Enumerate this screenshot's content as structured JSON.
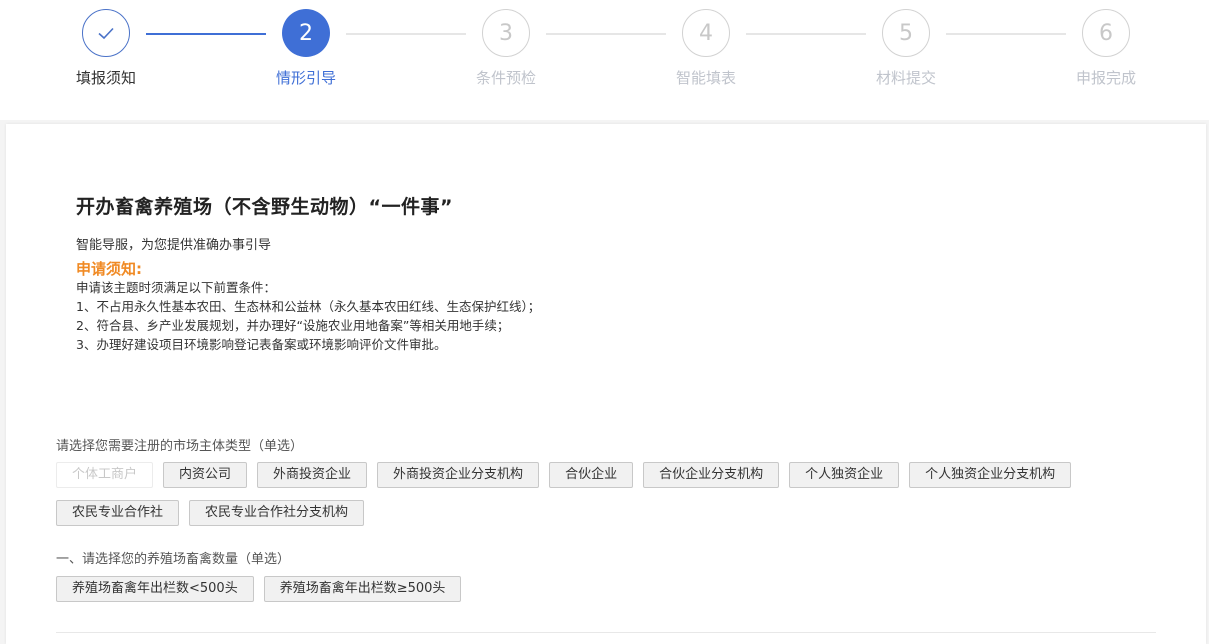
{
  "steps": [
    {
      "number": "",
      "label": "填报须知",
      "state": "done",
      "icon": "check-icon"
    },
    {
      "number": "2",
      "label": "情形引导",
      "state": "active"
    },
    {
      "number": "3",
      "label": "条件预检",
      "state": "todo"
    },
    {
      "number": "4",
      "label": "智能填表",
      "state": "todo"
    },
    {
      "number": "5",
      "label": "材料提交",
      "state": "todo"
    },
    {
      "number": "6",
      "label": "申报完成",
      "state": "todo"
    }
  ],
  "colors": {
    "accent": "#3f6fd6",
    "notice": "#f08a24",
    "inactive": "#c0c4cc"
  },
  "content": {
    "title": "开办畜禽养殖场（不含野生动物）“一件事”",
    "subtitle": "智能导服，为您提供准确办事引导",
    "notice_title": "申请须知:",
    "notice_lines": [
      "申请该主题时须满足以下前置条件：",
      "1、不占用永久性基本农田、生态林和公益林（永久基本农田红线、生态保护红线）；",
      "2、符合县、乡产业发展规划，并办理好“设施农业用地备案”等相关用地手续；",
      "3、办理好建设项目环境影响登记表备案或环境影响评价文件审批。"
    ]
  },
  "questions": [
    {
      "label": "请选择您需要注册的市场主体类型（单选）",
      "rows": [
        [
          "个体工商户",
          "内资公司",
          "外商投资企业",
          "外商投资企业分支机构",
          "合伙企业",
          "合伙企业分支机构",
          "个人独资企业",
          "个人独资企业分支机构"
        ],
        [
          "农民专业合作社",
          "农民专业合作社分支机构"
        ]
      ],
      "disabled": [
        "个体工商户"
      ]
    },
    {
      "label": "一、请选择您的养殖场畜禽数量（单选）",
      "rows": [
        [
          "养殖场畜禽年出栏数<500头",
          "养殖场畜禽年出栏数≥500头"
        ]
      ],
      "disabled": []
    }
  ]
}
